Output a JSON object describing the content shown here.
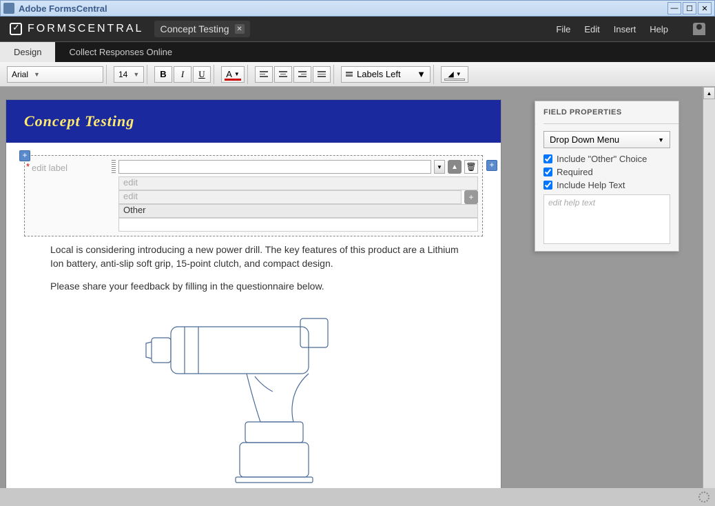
{
  "window": {
    "title": "Adobe FormsCentral"
  },
  "header": {
    "brand": "FORMSCENTRAL",
    "doc_title": "Concept Testing"
  },
  "menu": {
    "file": "File",
    "edit": "Edit",
    "insert": "Insert",
    "help": "Help"
  },
  "tabs": {
    "design": "Design",
    "collect": "Collect Responses Online"
  },
  "toolbar": {
    "font_family": "Arial",
    "font_size": "14",
    "labels": "Labels Left"
  },
  "form": {
    "title": "Concept Testing",
    "field": {
      "label_placeholder": "edit label",
      "opt1_placeholder": "edit",
      "opt2_placeholder": "edit",
      "opt3_value": "Other"
    },
    "para1": "Local is considering introducing a new power drill. The key features of this product are a Lithium Ion battery, anti-slip soft grip, 15-point clutch, and compact design.",
    "para2": "Please share your feedback by filling in the questionnaire below."
  },
  "props": {
    "title": "FIELD PROPERTIES",
    "type": "Drop Down Menu",
    "include_other": "Include \"Other\" Choice",
    "required": "Required",
    "include_help": "Include Help Text",
    "help_placeholder": "edit help text"
  }
}
